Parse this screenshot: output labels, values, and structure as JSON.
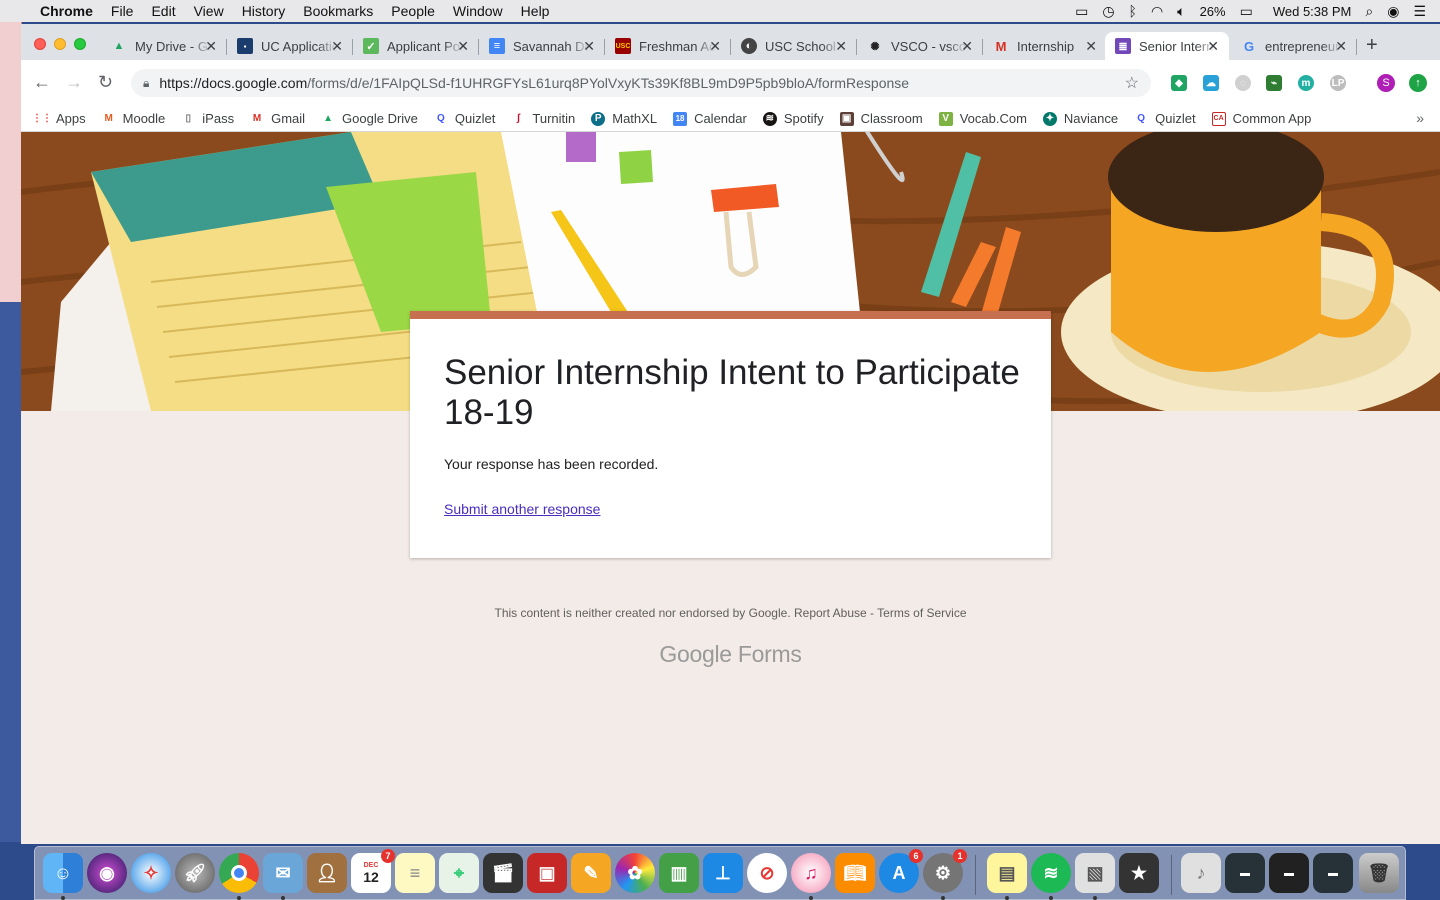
{
  "menubar": {
    "app": "Chrome",
    "items": [
      "File",
      "Edit",
      "View",
      "History",
      "Bookmarks",
      "People",
      "Window",
      "Help"
    ],
    "battery": "26%",
    "clock": "Wed 5:38 PM"
  },
  "tabs": [
    {
      "label": "My Drive - Google Drive",
      "icon": "drive-icon",
      "color": "#1fa463"
    },
    {
      "label": "UC Application",
      "icon": "uc-icon",
      "color": "#1a3d6e"
    },
    {
      "label": "Applicant Portal",
      "icon": "check-icon",
      "color": "#5cb85c"
    },
    {
      "label": "Savannah Docs",
      "icon": "docs-icon",
      "color": "#4285f4"
    },
    {
      "label": "Freshman Admission",
      "icon": "usc-icon",
      "color": "#990000"
    },
    {
      "label": "USC School",
      "icon": "usc-circle-icon",
      "color": "#444444"
    },
    {
      "label": "VSCO - vsco",
      "icon": "vsco-icon",
      "color": "#222222"
    },
    {
      "label": "Internship",
      "icon": "gmail-icon",
      "color": "#d93025"
    },
    {
      "label": "Senior Internship",
      "icon": "forms-icon",
      "color": "#7248b9",
      "active": true
    },
    {
      "label": "entrepreneur",
      "icon": "google-icon",
      "color": "#4285f4"
    }
  ],
  "omnibox": {
    "host": "https://docs.google.com",
    "path": "/forms/d/e/1FAIpQLSd-f1UHRGFYsL61urq8PYolVxyKTs39Kf8BL9mD9P5pb9bloA/formResponse"
  },
  "profile_initial": "S",
  "bookmarks": [
    {
      "label": "Apps",
      "icon": "apps-grid-icon",
      "color": "#ea4335"
    },
    {
      "label": "Moodle",
      "icon": "moodle-icon",
      "color": "#e35b1f"
    },
    {
      "label": "iPass",
      "icon": "page-icon",
      "color": "#777777"
    },
    {
      "label": "Gmail",
      "icon": "gmail-icon",
      "color": "#d93025"
    },
    {
      "label": "Google Drive",
      "icon": "drive-icon",
      "color": "#1fa463"
    },
    {
      "label": "Quizlet",
      "icon": "quizlet-icon",
      "color": "#4255ff"
    },
    {
      "label": "Turnitin",
      "icon": "turnitin-icon",
      "color": "#c8102e"
    },
    {
      "label": "MathXL",
      "icon": "mathxl-icon",
      "color": "#0d6e8a"
    },
    {
      "label": "Calendar",
      "icon": "calendar-icon",
      "color": "#4285f4"
    },
    {
      "label": "Spotify",
      "icon": "spotify-icon",
      "color": "#191414"
    },
    {
      "label": "Classroom",
      "icon": "classroom-icon",
      "color": "#5d4037"
    },
    {
      "label": "Vocab.Com",
      "icon": "vocab-icon",
      "color": "#7cb342"
    },
    {
      "label": "Naviance",
      "icon": "naviance-icon",
      "color": "#00796b"
    },
    {
      "label": "Quizlet",
      "icon": "quizlet-icon",
      "color": "#4255ff"
    },
    {
      "label": "Common App",
      "icon": "common-app-icon",
      "color": "#c62828"
    }
  ],
  "form": {
    "title": "Senior Internship Intent to Participate 18-19",
    "message": "Your response has been recorded.",
    "link": "Submit another response",
    "accent_color": "#c6704f"
  },
  "footer": {
    "note": "This content is neither created nor endorsed by Google. Report Abuse - Terms of Service",
    "logo_google": "Google",
    "logo_forms": "Forms"
  },
  "dock": {
    "calendar_date": "12",
    "calendar_month": "DEC",
    "calendar_badge": "7",
    "appstore_badge": "6",
    "prefs_badge": "1"
  }
}
